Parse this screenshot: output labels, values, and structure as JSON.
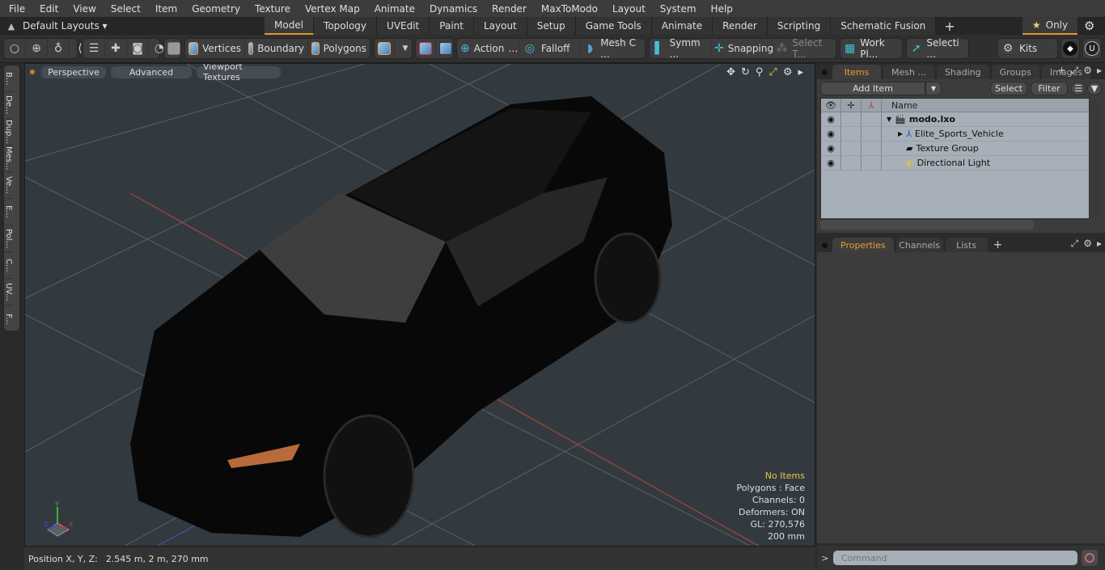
{
  "menu": [
    "File",
    "Edit",
    "View",
    "Select",
    "Item",
    "Geometry",
    "Texture",
    "Vertex Map",
    "Animate",
    "Dynamics",
    "Render",
    "MaxToModo",
    "Layout",
    "System",
    "Help"
  ],
  "layoutbar": {
    "layouts_label": "Default Layouts ▾",
    "tabs": [
      "Model",
      "Topology",
      "UVEdit",
      "Paint",
      "Layout",
      "Setup",
      "Game Tools",
      "Animate",
      "Render",
      "Scripting",
      "Schematic Fusion"
    ],
    "active_tab": "Model",
    "add_tab": "+",
    "only_label": "Only"
  },
  "toolbar": {
    "vertices": "Vertices",
    "boundary": "Boundary",
    "polygons": "Polygons",
    "action": "Action",
    "falloff": "Falloff",
    "mesh_c": "Mesh C ...",
    "symm": "Symm ...",
    "snapping": "Snapping",
    "select_t": "Select T...",
    "work_pl": "Work Pl...",
    "selecti": "Selecti ...",
    "kits": "Kits"
  },
  "left_strip": [
    "B...",
    "De...",
    "Dup...",
    "Mes...",
    "Ve...",
    "E...",
    "Pol...",
    "C...",
    "UV...",
    "F..."
  ],
  "viewport": {
    "view_mode": "Perspective",
    "shading": "Advanced",
    "textures": "Viewport Textures",
    "hud": {
      "selection": "No Items",
      "polygons": "Polygons : Face",
      "channels": "Channels: 0",
      "deformers": "Deformers: ON",
      "gl": "GL: 270,576",
      "scale": "200 mm"
    },
    "axes": {
      "x": "X",
      "y": "Y",
      "z": "Z"
    }
  },
  "status": {
    "label": "Position X, Y, Z:",
    "value": "2.545 m, 2 m, 270 mm"
  },
  "items_panel": {
    "tabs": [
      "Items",
      "Mesh ...",
      "Shading",
      "Groups",
      "Images"
    ],
    "active_tab": "Items",
    "add_item": "Add Item",
    "select": "Select",
    "filter": "Filter",
    "name_header": "Name",
    "rows": [
      {
        "name": "modo.lxo",
        "icon": "scene-icon",
        "level": 0,
        "bold": true
      },
      {
        "name": "Elite_Sports_Vehicle",
        "icon": "locator-icon",
        "level": 1,
        "bold": false
      },
      {
        "name": "Texture Group",
        "icon": "folder-icon",
        "level": 1,
        "bold": false
      },
      {
        "name": "Directional Light",
        "icon": "light-icon",
        "level": 1,
        "bold": false
      }
    ]
  },
  "properties_panel": {
    "tabs": [
      "Properties",
      "Channels",
      "Lists"
    ],
    "active_tab": "Properties"
  },
  "command": {
    "prompt": ">",
    "placeholder": "Command"
  },
  "colors": {
    "accent": "#e0952d",
    "viewport_bg": "#323a40",
    "tree_bg": "#a7b0b8",
    "hud_warn": "#e9c63f"
  }
}
